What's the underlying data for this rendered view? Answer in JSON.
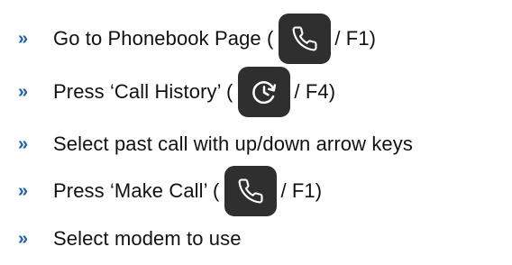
{
  "colors": {
    "bullet": "#1f5fa8",
    "button_bg": "#2f2f2f",
    "icon": "#ffffff",
    "text": "#111111"
  },
  "bullet_glyph": "»",
  "steps": [
    {
      "before": "Go to Phonebook Page (",
      "icon": "phone-icon",
      "after": " / F1)"
    },
    {
      "before": "Press ‘Call History’ (",
      "icon": "history-icon",
      "after": " / F4)"
    },
    {
      "text": "Select past call with up/down arrow keys"
    },
    {
      "before": "Press ‘Make Call’ (",
      "icon": "phone-icon",
      "after": " / F1)"
    },
    {
      "text": "Select modem to use"
    }
  ]
}
